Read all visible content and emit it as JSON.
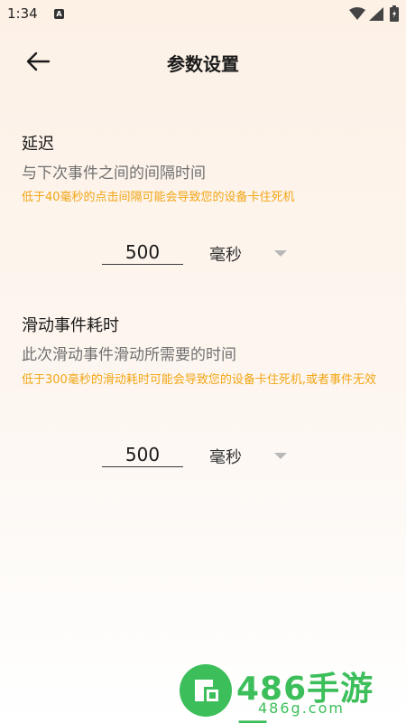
{
  "status_bar": {
    "time": "1:34",
    "badge": "A"
  },
  "header": {
    "title": "参数设置"
  },
  "delay": {
    "title": "延迟",
    "description": "与下次事件之间的间隔时间",
    "warning": "低于40毫秒的点击间隔可能会导致您的设备卡住死机",
    "value": "500",
    "unit": "毫秒"
  },
  "swipe": {
    "title": "滑动事件耗时",
    "description": "此次滑动事件滑动所需要的时间",
    "warning": "低于300毫秒的滑动耗时可能会导致您的设备卡住死机,或者事件无效",
    "value": "500",
    "unit": "毫秒"
  },
  "watermark": {
    "brand": "486手游网",
    "url": "486g.com"
  },
  "colors": {
    "warning": "#f2a515",
    "watermark": "#3cbf5a"
  }
}
